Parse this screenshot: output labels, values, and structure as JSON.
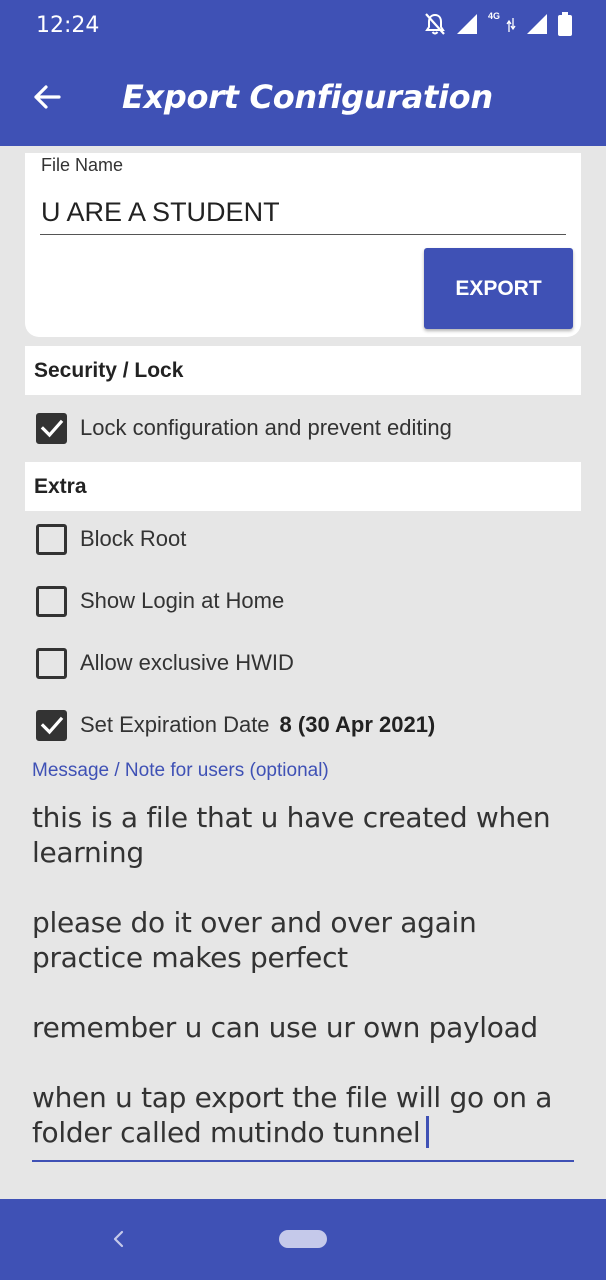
{
  "status_bar": {
    "time": "12:24",
    "network": "4G",
    "icons": [
      "bell-off-icon",
      "signal-icon",
      "4g-signal-icon",
      "battery-icon"
    ]
  },
  "app_bar": {
    "title": "Export Configuration",
    "back_icon": "arrow-left-icon"
  },
  "file_card": {
    "label": "File Name",
    "value": "U ARE A STUDENT",
    "export_label": "EXPORT"
  },
  "security": {
    "header": "Security / Lock",
    "options": [
      {
        "label": "Lock configuration and prevent editing",
        "checked": true
      }
    ]
  },
  "extra": {
    "header": "Extra",
    "options": [
      {
        "label": "Block Root",
        "checked": false
      },
      {
        "label": "Show Login at Home",
        "checked": false
      },
      {
        "label": "Allow exclusive HWID",
        "checked": false
      },
      {
        "label": "Set Expiration Date",
        "checked": true,
        "value": "8 (30 Apr 2021)"
      }
    ]
  },
  "message": {
    "label": "Message / Note for users (optional)",
    "lines": [
      "this is a file that u have created when",
      "learning",
      "",
      "please do it over and over again",
      "practice makes perfect",
      "",
      "remember u can use ur own payload",
      "",
      "when u tap export the file will go on a",
      "folder called mutindo tunnel"
    ]
  },
  "colors": {
    "primary": "#3f51b5",
    "background": "#e6e6e6",
    "card": "#ffffff",
    "checkbox": "#333333"
  }
}
